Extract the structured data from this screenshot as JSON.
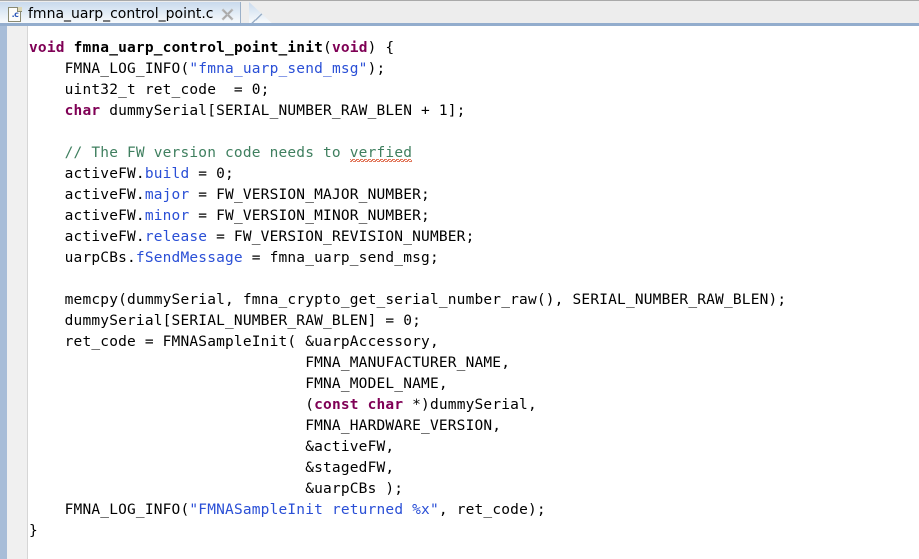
{
  "window": {
    "title": "fmna_uarp_control_point.c",
    "type": "code-editor"
  },
  "tab_bar": {
    "active_tab": {
      "label": "fmna_uarp_control_point.c",
      "icon_name": "c-source-file-icon",
      "icon_extension": ".c",
      "close_icon_name": "close-icon",
      "close_label": "×"
    },
    "background_color": "#ededed",
    "underline_color": "#93adcd"
  },
  "gutter": {
    "accent_color": "#a8bdd8",
    "background_color": "#f0f0f0"
  },
  "theme": {
    "keyword_color": "#7f0055",
    "string_color": "#2a4fd6",
    "comment_color": "#3f7f5f",
    "field_color": "#2a4fd6",
    "text_color": "#000000",
    "background_color": "#ffffff",
    "spellcheck_underline_color": "#d94f2b"
  },
  "code": {
    "language": "C",
    "lines": [
      "void fmna_uarp_control_point_init(void) {",
      "    FMNA_LOG_INFO(\"fmna_uarp_send_msg\");",
      "    uint32_t ret_code  = 0;",
      "    char dummySerial[SERIAL_NUMBER_RAW_BLEN + 1];",
      "",
      "    // The FW version code needs to verfied",
      "    activeFW.build = 0;",
      "    activeFW.major = FW_VERSION_MAJOR_NUMBER;",
      "    activeFW.minor = FW_VERSION_MINOR_NUMBER;",
      "    activeFW.release = FW_VERSION_REVISION_NUMBER;",
      "    uarpCBs.fSendMessage = fmna_uarp_send_msg;",
      "",
      "    memcpy(dummySerial, fmna_crypto_get_serial_number_raw(), SERIAL_NUMBER_RAW_BLEN);",
      "    dummySerial[SERIAL_NUMBER_RAW_BLEN] = 0;",
      "    ret_code = FMNASampleInit( &uarpAccessory,",
      "                               FMNA_MANUFACTURER_NAME,",
      "                               FMNA_MODEL_NAME,",
      "                               (const char *)dummySerial,",
      "                               FMNA_HARDWARE_VERSION,",
      "                               &activeFW,",
      "                               &stagedFW,",
      "                               &uarpCBs );",
      "    FMNA_LOG_INFO(\"FMNASampleInit returned %x\", ret_code);",
      "}"
    ],
    "tokens": [
      [
        {
          "t": "void",
          "c": "kw"
        },
        {
          "t": " ",
          "c": "plain"
        },
        {
          "t": "fmna_uarp_control_point_init",
          "c": "kwname"
        },
        {
          "t": "(",
          "c": "plain"
        },
        {
          "t": "void",
          "c": "kw"
        },
        {
          "t": ") {",
          "c": "plain"
        }
      ],
      [
        {
          "t": "    FMNA_LOG_INFO(",
          "c": "plain"
        },
        {
          "t": "\"fmna_uarp_send_msg\"",
          "c": "str"
        },
        {
          "t": ");",
          "c": "plain"
        }
      ],
      [
        {
          "t": "    uint32_t ret_code  = 0;",
          "c": "plain"
        }
      ],
      [
        {
          "t": "    ",
          "c": "plain"
        },
        {
          "t": "char",
          "c": "kw"
        },
        {
          "t": " dummySerial[SERIAL_NUMBER_RAW_BLEN + 1];",
          "c": "plain"
        }
      ],
      [
        {
          "t": "",
          "c": "plain"
        }
      ],
      [
        {
          "t": "    ",
          "c": "plain"
        },
        {
          "t": "// The FW version code needs to ",
          "c": "cmt"
        },
        {
          "t": "verfied",
          "c": "cmt-misspelled"
        }
      ],
      [
        {
          "t": "    activeFW.",
          "c": "plain"
        },
        {
          "t": "build",
          "c": "fld"
        },
        {
          "t": " = 0;",
          "c": "plain"
        }
      ],
      [
        {
          "t": "    activeFW.",
          "c": "plain"
        },
        {
          "t": "major",
          "c": "fld"
        },
        {
          "t": " = FW_VERSION_MAJOR_NUMBER;",
          "c": "plain"
        }
      ],
      [
        {
          "t": "    activeFW.",
          "c": "plain"
        },
        {
          "t": "minor",
          "c": "fld"
        },
        {
          "t": " = FW_VERSION_MINOR_NUMBER;",
          "c": "plain"
        }
      ],
      [
        {
          "t": "    activeFW.",
          "c": "plain"
        },
        {
          "t": "release",
          "c": "fld"
        },
        {
          "t": " = FW_VERSION_REVISION_NUMBER;",
          "c": "plain"
        }
      ],
      [
        {
          "t": "    uarpCBs.",
          "c": "plain"
        },
        {
          "t": "fSendMessage",
          "c": "fld"
        },
        {
          "t": " = fmna_uarp_send_msg;",
          "c": "plain"
        }
      ],
      [
        {
          "t": "",
          "c": "plain"
        }
      ],
      [
        {
          "t": "    memcpy(dummySerial, fmna_crypto_get_serial_number_raw(), SERIAL_NUMBER_RAW_BLEN);",
          "c": "plain"
        }
      ],
      [
        {
          "t": "    dummySerial[SERIAL_NUMBER_RAW_BLEN] = 0;",
          "c": "plain"
        }
      ],
      [
        {
          "t": "    ret_code = FMNASampleInit( &uarpAccessory,",
          "c": "plain"
        }
      ],
      [
        {
          "t": "                               FMNA_MANUFACTURER_NAME,",
          "c": "plain"
        }
      ],
      [
        {
          "t": "                               FMNA_MODEL_NAME,",
          "c": "plain"
        }
      ],
      [
        {
          "t": "                               (",
          "c": "plain"
        },
        {
          "t": "const char",
          "c": "kw"
        },
        {
          "t": " *)dummySerial,",
          "c": "plain"
        }
      ],
      [
        {
          "t": "                               FMNA_HARDWARE_VERSION,",
          "c": "plain"
        }
      ],
      [
        {
          "t": "                               &activeFW,",
          "c": "plain"
        }
      ],
      [
        {
          "t": "                               &stagedFW,",
          "c": "plain"
        }
      ],
      [
        {
          "t": "                               &uarpCBs );",
          "c": "plain"
        }
      ],
      [
        {
          "t": "    FMNA_LOG_INFO(",
          "c": "plain"
        },
        {
          "t": "\"FMNASampleInit returned %x\"",
          "c": "str"
        },
        {
          "t": ", ret_code);",
          "c": "plain"
        }
      ],
      [
        {
          "t": "}",
          "c": "plain"
        }
      ]
    ]
  }
}
